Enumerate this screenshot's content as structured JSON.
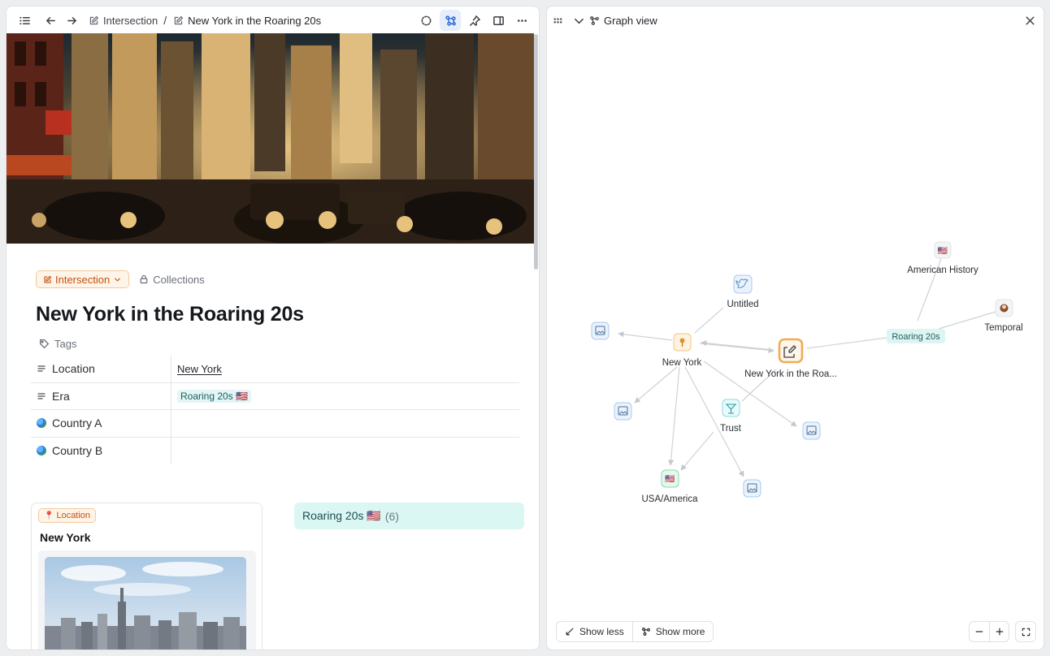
{
  "left_pane": {
    "breadcrumb": {
      "parent": "Intersection",
      "separator": "/",
      "current": "New York in the Roaring 20s"
    },
    "document": {
      "type_chip": "Intersection",
      "collections_label": "Collections",
      "title": "New York in the Roaring 20s",
      "tags_label": "Tags",
      "properties": [
        {
          "name": "Location",
          "value": "New York"
        },
        {
          "name": "Era",
          "value": "Roaring 20s 🇺🇸"
        },
        {
          "name": "Country A",
          "value": ""
        },
        {
          "name": "Country B",
          "value": ""
        }
      ]
    },
    "location_card": {
      "chip": "Location",
      "title": "New York"
    },
    "group_card": {
      "label": "Roaring 20s 🇺🇸",
      "count": "(6)"
    }
  },
  "right_pane": {
    "title": "Graph view",
    "graph": {
      "nodes": {
        "american_history": "American History",
        "untitled": "Untitled",
        "temporal": "Temporal",
        "roaring": "Roaring 20s",
        "new_york": "New York",
        "current": "New York in the Roa...",
        "trust": "Trust",
        "usa": "USA/America"
      }
    },
    "buttons": {
      "show_less": "Show less",
      "show_more": "Show more"
    }
  },
  "colors": {
    "accent": "#2e6bd6",
    "intersection": "#c2510f",
    "tag_bg": "#e3f6f5"
  }
}
